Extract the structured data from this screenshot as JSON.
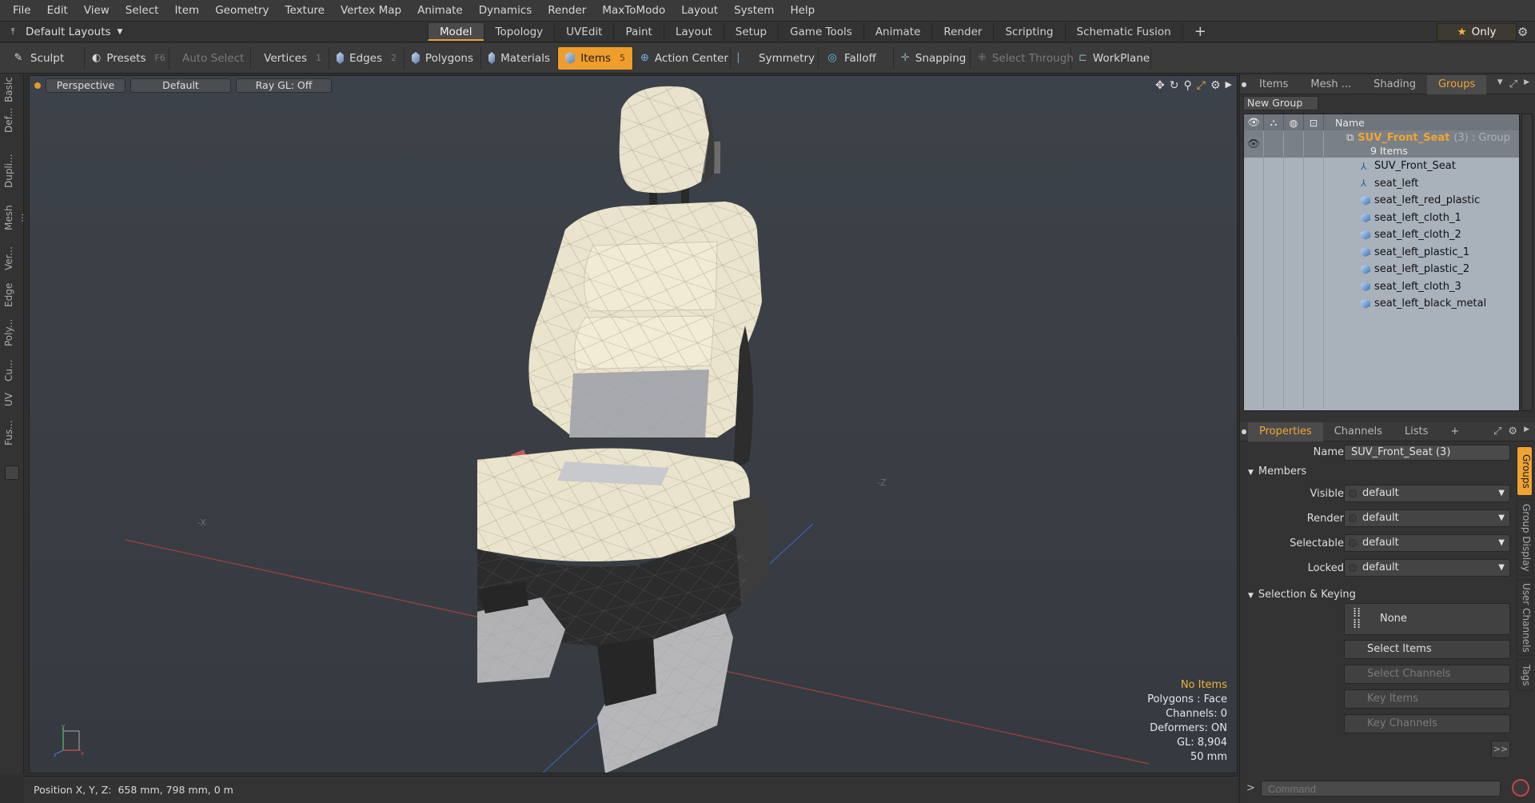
{
  "menu": [
    "File",
    "Edit",
    "View",
    "Select",
    "Item",
    "Geometry",
    "Texture",
    "Vertex Map",
    "Animate",
    "Dynamics",
    "Render",
    "MaxToModo",
    "Layout",
    "System",
    "Help"
  ],
  "layouts_dropdown": "Default Layouts",
  "layout_tabs": [
    {
      "label": "Model",
      "active": true
    },
    {
      "label": "Topology",
      "active": false
    },
    {
      "label": "UVEdit",
      "active": false
    },
    {
      "label": "Paint",
      "active": false
    },
    {
      "label": "Layout",
      "active": false
    },
    {
      "label": "Setup",
      "active": false
    },
    {
      "label": "Game Tools",
      "active": false
    },
    {
      "label": "Animate",
      "active": false
    },
    {
      "label": "Render",
      "active": false
    },
    {
      "label": "Scripting",
      "active": false
    },
    {
      "label": "Schematic Fusion",
      "active": false
    }
  ],
  "only_button": "Only",
  "toolbar": {
    "sculpt": "Sculpt",
    "presets": "Presets",
    "presets_key": "F6",
    "auto_select": "Auto Select",
    "vertices": "Vertices",
    "vertices_key": "1",
    "edges": "Edges",
    "edges_key": "2",
    "polygons": "Polygons",
    "materials": "Materials",
    "items": "Items",
    "items_key": "5",
    "action_center": "Action Center",
    "symmetry": "Symmetry",
    "falloff": "Falloff",
    "snapping": "Snapping",
    "select_through": "Select Through",
    "workplane": "WorkPlane"
  },
  "left_tabs": [
    "Basic",
    "Def...",
    "Dupli...",
    "Mesh ...",
    "Ver...",
    "Edge",
    "Poly...",
    "Cu...",
    "UV",
    "Fus..."
  ],
  "viewport": {
    "view": "Perspective",
    "shading": "Default",
    "raygl": "Ray GL: Off",
    "info": {
      "no_items": "No Items",
      "polygons": "Polygons : Face",
      "channels": "Channels: 0",
      "deformers": "Deformers: ON",
      "gl": "GL: 8,904",
      "size": "50 mm"
    }
  },
  "status": "Position X, Y, Z:  658 mm, 798 mm, 0 m",
  "panel_tabs": [
    {
      "label": "Items",
      "active": false
    },
    {
      "label": "Mesh ...",
      "active": false
    },
    {
      "label": "Shading",
      "active": false
    },
    {
      "label": "Groups",
      "active": true
    }
  ],
  "new_group": "New Group",
  "list_header": "Name",
  "group": {
    "name": "SUV_Front_Seat",
    "suffix": "(3) : Group",
    "count": "9 Items"
  },
  "group_items": [
    {
      "name": "SUV_Front_Seat",
      "type": "locator"
    },
    {
      "name": "seat_left",
      "type": "locator"
    },
    {
      "name": "seat_left_red_plastic",
      "type": "mesh"
    },
    {
      "name": "seat_left_cloth_1",
      "type": "mesh"
    },
    {
      "name": "seat_left_cloth_2",
      "type": "mesh"
    },
    {
      "name": "seat_left_plastic_1",
      "type": "mesh"
    },
    {
      "name": "seat_left_plastic_2",
      "type": "mesh"
    },
    {
      "name": "seat_left_cloth_3",
      "type": "mesh"
    },
    {
      "name": "seat_left_black_metal",
      "type": "mesh"
    }
  ],
  "prop_tabs": [
    {
      "label": "Properties",
      "active": true
    },
    {
      "label": "Channels",
      "active": false
    },
    {
      "label": "Lists",
      "active": false
    }
  ],
  "properties": {
    "name_label": "Name",
    "name_value": "SUV_Front_Seat (3)",
    "members": "Members",
    "visible_label": "Visible",
    "visible": "default",
    "render_label": "Render",
    "render": "default",
    "selectable_label": "Selectable",
    "selectable": "default",
    "locked_label": "Locked",
    "locked": "default",
    "sel_keying": "Selection & Keying",
    "none": "None",
    "select_items": "Select Items",
    "select_channels": "Select Channels",
    "key_items": "Key Items",
    "key_channels": "Key Channels",
    "more": ">>"
  },
  "right_vtabs": [
    "Groups",
    "Group Display",
    "User Channels",
    "Tags"
  ],
  "command_placeholder": "Command",
  "colors": {
    "accent": "#ef9d2c",
    "group_label": "#f3a52f"
  }
}
